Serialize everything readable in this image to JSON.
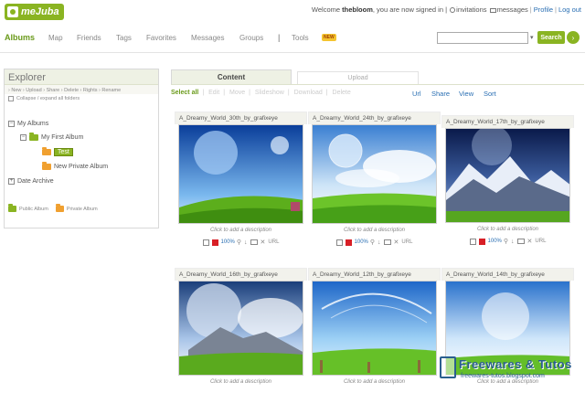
{
  "header": {
    "logo_text": "meJuba",
    "welcome_prefix": "Welcome",
    "username": "thebloom",
    "signed_in_text": ", you are now signed in |",
    "invitations": "invitations",
    "messages": "messages",
    "profile": "Profile",
    "logout": "Log out"
  },
  "nav": {
    "items": [
      "Albums",
      "Map",
      "Friends",
      "Tags",
      "Favorites",
      "Messages",
      "Groups",
      "Tools"
    ],
    "badge": "NEW",
    "search_label": "Search"
  },
  "explorer": {
    "title": "Explorer",
    "actions": "› New › Upload › Share › Delete › Rights › Rename",
    "collapse": "Collapse / expand all folders",
    "tree": [
      "My Albums",
      "My First Album",
      "Test",
      "New Private Album",
      "Date Archive"
    ],
    "legend_public": "Public Album",
    "legend_private": "Private Album"
  },
  "tabs": {
    "content": "Content",
    "upload": "Upload"
  },
  "toolbar": {
    "left": [
      "Select all",
      "Edit",
      "Move",
      "Slideshow",
      "Download",
      "Delete"
    ],
    "right": [
      "Url",
      "Share",
      "View",
      "Sort"
    ]
  },
  "photos": [
    {
      "title": "A_Dreamy_World_30th_by_grafixeye",
      "desc": "Click to add a description",
      "percent": "100%",
      "url": "URL"
    },
    {
      "title": "A_Dreamy_World_24th_by_grafixeye",
      "desc": "Click to add a description",
      "percent": "100%",
      "url": "URL"
    },
    {
      "title": "A_Dreamy_World_17th_by_grafixeye",
      "desc": "Click to add a description",
      "percent": "100%",
      "url": "URL"
    },
    {
      "title": "A_Dreamy_World_16th_by_grafixeye",
      "desc": "Click to add a description"
    },
    {
      "title": "A_Dreamy_World_12th_by_grafixeye",
      "desc": "Click to add a description"
    },
    {
      "title": "A_Dreamy_World_14th_by_grafixeye",
      "desc": "Click to add a description"
    }
  ],
  "watermark": {
    "title": "Freewares & Tutos",
    "sub": "freewares-tutos.blogspot.com"
  },
  "colors": {
    "accent": "#8ab422",
    "link": "#2a6fb3",
    "private": "#f0a030"
  }
}
